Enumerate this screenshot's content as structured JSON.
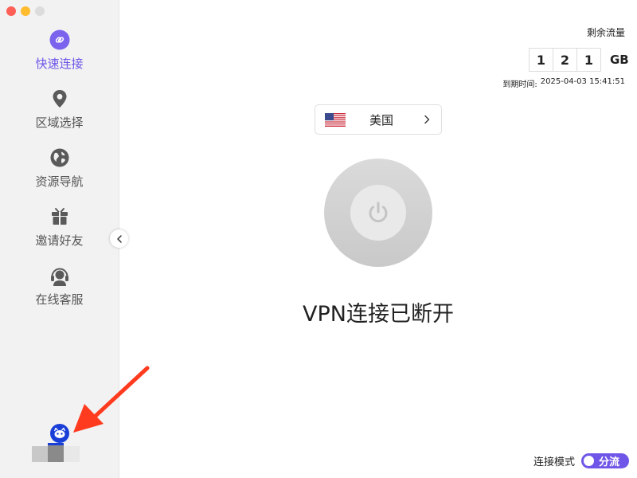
{
  "sidebar": {
    "items": [
      {
        "label": "快速连接",
        "icon": "link-icon",
        "active": true
      },
      {
        "label": "区域选择",
        "icon": "location-pin-icon",
        "active": false
      },
      {
        "label": "资源导航",
        "icon": "globe-icon",
        "active": false
      },
      {
        "label": "邀请好友",
        "icon": "gift-icon",
        "active": false
      },
      {
        "label": "在线客服",
        "icon": "headset-icon",
        "active": false
      }
    ]
  },
  "quota": {
    "label": "剩余流量",
    "digits": [
      "1",
      "2",
      "1"
    ],
    "unit": "GB",
    "expire_label": "到期时间:",
    "expire_value": "2025-04-03 15:41:51"
  },
  "region": {
    "name": "美国",
    "flag": "us-flag-icon"
  },
  "connection": {
    "status": "VPN连接已断开"
  },
  "mode": {
    "label": "连接模式",
    "value": "分流"
  },
  "colors": {
    "accent": "#6f56e8",
    "sidebar_bg": "#f2f2f2",
    "arrow": "#ff3b1f",
    "logo": "#1a3fd8"
  }
}
